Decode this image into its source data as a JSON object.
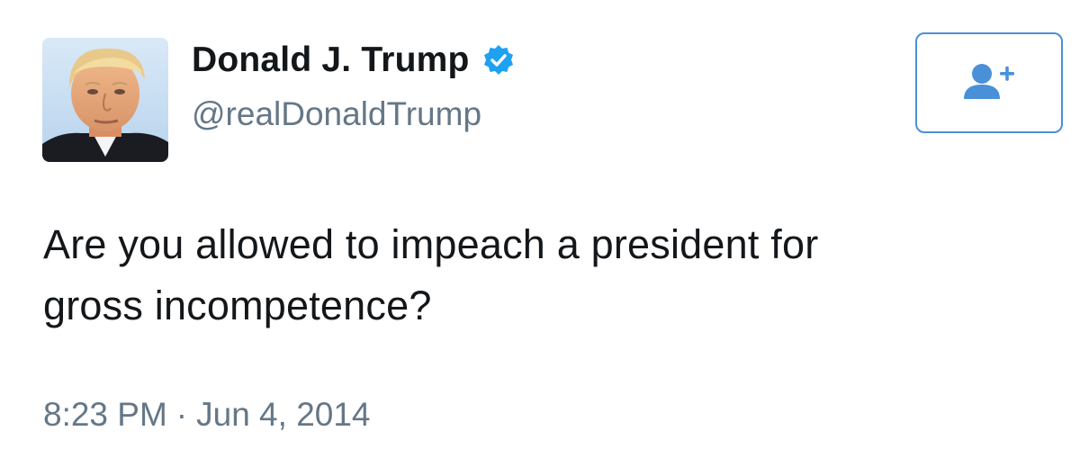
{
  "tweet": {
    "display_name": "Donald J. Trump",
    "handle": "@realDonaldTrump",
    "text_line1": "Are you allowed to impeach a president for",
    "text_line2": "gross incompetence?",
    "time": "8:23 PM",
    "separator": "·",
    "date": "Jun 4, 2014"
  },
  "icons": {
    "verified": "verified-badge-icon",
    "follow": "add-user-icon",
    "avatar": "profile-photo"
  },
  "colors": {
    "verified": "#1da1f2",
    "follow_accent": "#4a90d9",
    "secondary_text": "#657786",
    "primary_text": "#14171a"
  }
}
